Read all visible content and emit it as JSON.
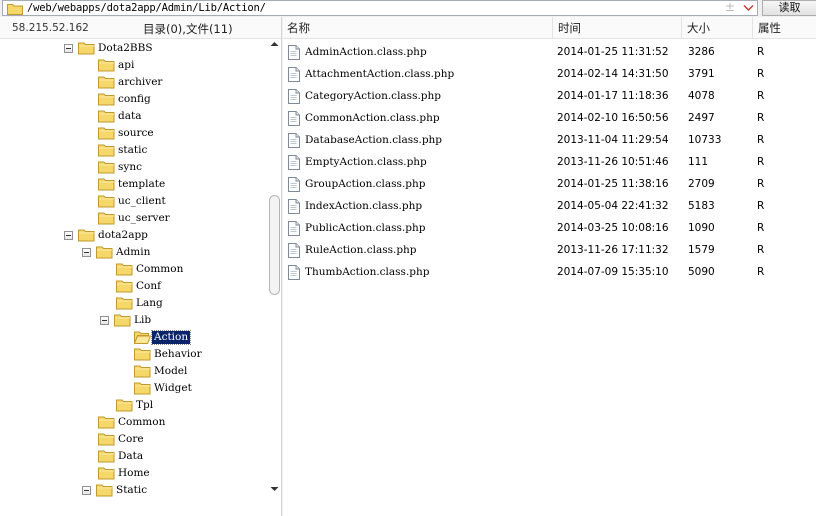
{
  "pathbar": {
    "path": "/web/webapps/dota2app/Admin/Lib/Action/",
    "plus_glyph": "±",
    "read_button_label": "读取"
  },
  "left": {
    "server_ip": "58.215.52.162",
    "dir_summary": "目录(0),文件(11)"
  },
  "tree": [
    {
      "label": "Dota2BBS",
      "depth": 0,
      "expanded": true
    },
    {
      "label": "api",
      "depth": 1
    },
    {
      "label": "archiver",
      "depth": 1
    },
    {
      "label": "config",
      "depth": 1
    },
    {
      "label": "data",
      "depth": 1
    },
    {
      "label": "source",
      "depth": 1
    },
    {
      "label": "static",
      "depth": 1
    },
    {
      "label": "sync",
      "depth": 1
    },
    {
      "label": "template",
      "depth": 1
    },
    {
      "label": "uc_client",
      "depth": 1
    },
    {
      "label": "uc_server",
      "depth": 1
    },
    {
      "label": "dota2app",
      "depth": 0,
      "expanded": true
    },
    {
      "label": "Admin",
      "depth": 1,
      "expanded": true
    },
    {
      "label": "Common",
      "depth": 2
    },
    {
      "label": "Conf",
      "depth": 2
    },
    {
      "label": "Lang",
      "depth": 2
    },
    {
      "label": "Lib",
      "depth": 2,
      "expanded": true
    },
    {
      "label": "Action",
      "depth": 3,
      "selected": true,
      "open": true
    },
    {
      "label": "Behavior",
      "depth": 3
    },
    {
      "label": "Model",
      "depth": 3
    },
    {
      "label": "Widget",
      "depth": 3
    },
    {
      "label": "Tpl",
      "depth": 2
    },
    {
      "label": "Common",
      "depth": 1
    },
    {
      "label": "Core",
      "depth": 1
    },
    {
      "label": "Data",
      "depth": 1
    },
    {
      "label": "Home",
      "depth": 1
    },
    {
      "label": "Static",
      "depth": 1,
      "expanded": true
    }
  ],
  "columns": {
    "name": "名称",
    "time": "时间",
    "size": "大小",
    "attr": "属性"
  },
  "files": [
    {
      "name": "AdminAction.class.php",
      "time": "2014-01-25 11:31:52",
      "size": "3286",
      "attr": "R"
    },
    {
      "name": "AttachmentAction.class.php",
      "time": "2014-02-14 14:31:50",
      "size": "3791",
      "attr": "R"
    },
    {
      "name": "CategoryAction.class.php",
      "time": "2014-01-17 11:18:36",
      "size": "4078",
      "attr": "R"
    },
    {
      "name": "CommonAction.class.php",
      "time": "2014-02-10 16:50:56",
      "size": "2497",
      "attr": "R"
    },
    {
      "name": "DatabaseAction.class.php",
      "time": "2013-11-04 11:29:54",
      "size": "10733",
      "attr": "R"
    },
    {
      "name": "EmptyAction.class.php",
      "time": "2013-11-26 10:51:46",
      "size": "111",
      "attr": "R"
    },
    {
      "name": "GroupAction.class.php",
      "time": "2014-01-25 11:38:16",
      "size": "2709",
      "attr": "R"
    },
    {
      "name": "IndexAction.class.php",
      "time": "2014-05-04 22:41:32",
      "size": "5183",
      "attr": "R"
    },
    {
      "name": "PublicAction.class.php",
      "time": "2014-03-25 10:08:16",
      "size": "1090",
      "attr": "R"
    },
    {
      "name": "RuleAction.class.php",
      "time": "2013-11-26 17:11:32",
      "size": "1579",
      "attr": "R"
    },
    {
      "name": "ThumbAction.class.php",
      "time": "2014-07-09 15:35:10",
      "size": "5090",
      "attr": "R"
    }
  ],
  "icons": {
    "folder": "folder-icon",
    "folder_open": "folder-open-icon",
    "file": "php-file-icon",
    "toggle": "collapse-toggle-icon"
  },
  "colors": {
    "folder_fill": "#f6d76a",
    "folder_stroke": "#c29a2c",
    "selection": "#0a246a"
  }
}
